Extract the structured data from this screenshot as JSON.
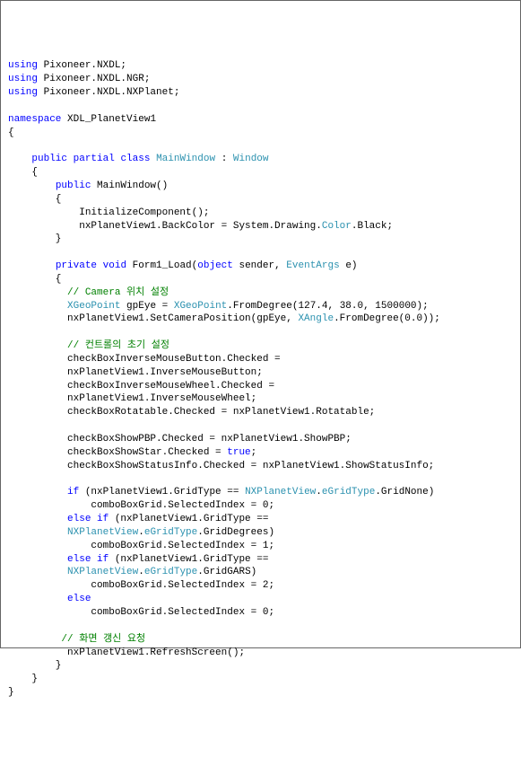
{
  "code": {
    "l1_kw1": "using",
    "l1_txt": " Pixoneer.NXDL;",
    "l2_kw1": "using",
    "l2_txt": " Pixoneer.NXDL.NGR;",
    "l3_kw1": "using",
    "l3_txt": " Pixoneer.NXDL.NXPlanet;",
    "l4": "",
    "l5_kw1": "namespace",
    "l5_txt": " XDL_PlanetView1",
    "l6": "{",
    "l7": "",
    "l8_indent": "    ",
    "l8_kw1": "public",
    "l8_sp1": " ",
    "l8_kw2": "partial",
    "l8_sp2": " ",
    "l8_kw3": "class",
    "l8_sp3": " ",
    "l8_type": "MainWindow",
    "l8_txt": " : ",
    "l8_type2": "Window",
    "l9": "    {",
    "l10_indent": "        ",
    "l10_kw1": "public",
    "l10_txt": " MainWindow()",
    "l11": "        {",
    "l12": "            InitializeComponent();",
    "l13_txt1": "            nxPlanetView1.BackColor = System.Drawing.",
    "l13_type": "Color",
    "l13_txt2": ".Black;",
    "l14": "        }",
    "l15": "",
    "l16_indent": "        ",
    "l16_kw1": "private",
    "l16_sp1": " ",
    "l16_kw2": "void",
    "l16_txt1": " Form1_Load(",
    "l16_kw3": "object",
    "l16_txt2": " sender, ",
    "l16_type": "EventArgs",
    "l16_txt3": " e)",
    "l17": "        {",
    "l18_indent": "          ",
    "l18_cmt": "// Camera 위치 설정",
    "l19_indent": "          ",
    "l19_type1": "XGeoPoint",
    "l19_txt1": " gpEye = ",
    "l19_type2": "XGeoPoint",
    "l19_txt2": ".FromDegree(127.4, 38.0, 1500000);",
    "l20_txt1": "          nxPlanetView1.SetCameraPosition(gpEye, ",
    "l20_type": "XAngle",
    "l20_txt2": ".FromDegree(0.0));",
    "l21": "",
    "l22_indent": "          ",
    "l22_cmt": "// 컨트롤의 초기 설정",
    "l23": "          checkBoxInverseMouseButton.Checked =",
    "l24": "          nxPlanetView1.InverseMouseButton;",
    "l25": "          checkBoxInverseMouseWheel.Checked =",
    "l26": "          nxPlanetView1.InverseMouseWheel;",
    "l27": "          checkBoxRotatable.Checked = nxPlanetView1.Rotatable;",
    "l28": "",
    "l29": "          checkBoxShowPBP.Checked = nxPlanetView1.ShowPBP;",
    "l30_txt1": "          checkBoxShowStar.Checked = ",
    "l30_kw": "true",
    "l30_txt2": ";",
    "l31": "          checkBoxShowStatusInfo.Checked = nxPlanetView1.ShowStatusInfo;",
    "l32": "",
    "l33_indent": "          ",
    "l33_kw": "if",
    "l33_txt1": " (nxPlanetView1.GridType == ",
    "l33_type": "NXPlanetView",
    "l33_txt2": ".",
    "l33_type2": "eGridType",
    "l33_txt3": ".GridNone)",
    "l34": "              comboBoxGrid.SelectedIndex = 0;",
    "l35_indent": "          ",
    "l35_kw1": "else",
    "l35_sp": " ",
    "l35_kw2": "if",
    "l35_txt": " (nxPlanetView1.GridType ==",
    "l36_indent": "          ",
    "l36_type1": "NXPlanetView",
    "l36_txt1": ".",
    "l36_type2": "eGridType",
    "l36_txt2": ".GridDegrees)",
    "l37": "              comboBoxGrid.SelectedIndex = 1;",
    "l38_indent": "          ",
    "l38_kw1": "else",
    "l38_sp": " ",
    "l38_kw2": "if",
    "l38_txt": " (nxPlanetView1.GridType ==",
    "l39_indent": "          ",
    "l39_type1": "NXPlanetView",
    "l39_txt1": ".",
    "l39_type2": "eGridType",
    "l39_txt2": ".GridGARS)",
    "l40": "              comboBoxGrid.SelectedIndex = 2;",
    "l41_indent": "          ",
    "l41_kw": "else",
    "l42": "              comboBoxGrid.SelectedIndex = 0;",
    "l43": "",
    "l44_indent": "         ",
    "l44_cmt": "// 화면 갱신 요청",
    "l45": "          nxPlanetView1.RefreshScreen();",
    "l46": "        }",
    "l47": "    }",
    "l48": "}"
  }
}
